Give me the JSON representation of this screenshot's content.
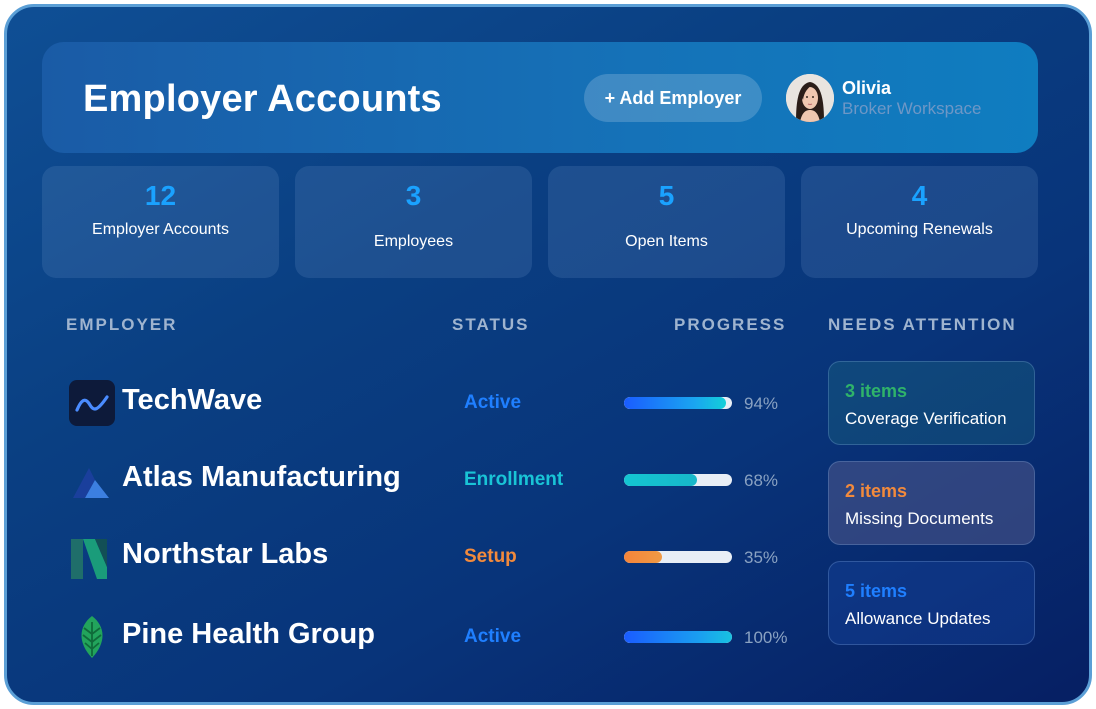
{
  "header": {
    "title": "Employer Accounts",
    "add_button_label": "+ Add Employer",
    "user": {
      "name": "Olivia",
      "role": "Broker Workspace"
    }
  },
  "stats": [
    {
      "value": "12",
      "label": "Employer Accounts"
    },
    {
      "value": "3",
      "label": "Employees"
    },
    {
      "value": "5",
      "label": "Open Items"
    },
    {
      "value": "4",
      "label": "Upcoming Renewals"
    }
  ],
  "columns": {
    "employer": "EMPLOYER",
    "status": "STATUS",
    "progress": "PROGRESS",
    "needs_attention": "NEEDS ATTENTION"
  },
  "employers": [
    {
      "name": "TechWave",
      "logo_icon": "wave-icon",
      "status": "Active",
      "status_color": "#1f7fff",
      "progress": 94,
      "progress_label": "94%"
    },
    {
      "name": "Atlas Manufacturing",
      "logo_icon": "mountain-icon",
      "status": "Enrollment",
      "status_color": "#19c4d6",
      "progress": 68,
      "progress_label": "68%"
    },
    {
      "name": "Northstar Labs",
      "logo_icon": "letter-n-icon",
      "status": "Setup",
      "status_color": "#f28a3c",
      "progress": 35,
      "progress_label": "35%"
    },
    {
      "name": "Pine Health Group",
      "logo_icon": "leaf-icon",
      "status": "Active",
      "status_color": "#1f7fff",
      "progress": 100,
      "progress_label": "100%"
    }
  ],
  "attention": [
    {
      "count": "3 items",
      "label": "Coverage Verification",
      "color": "#2fb36a"
    },
    {
      "count": "2 items",
      "label": "Missing Documents",
      "color": "#f28a3c"
    },
    {
      "count": "5 items",
      "label": "Allowance Updates",
      "color": "#1f7fff"
    }
  ]
}
